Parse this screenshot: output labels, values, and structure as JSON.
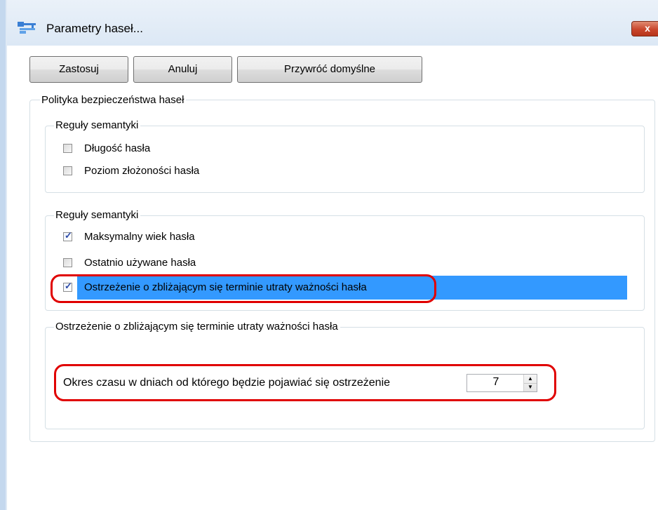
{
  "window": {
    "title": "Parametry haseł...",
    "close_glyph": "x",
    "icon": "app-key-icon"
  },
  "toolbar": {
    "apply_label": "Zastosuj",
    "cancel_label": "Anuluj",
    "restore_label": "Przywróć domyślne"
  },
  "policy": {
    "title": "Polityka bezpieczeństwa haseł",
    "semantics1": {
      "title": "Reguły semantyki",
      "items": [
        {
          "label": "Długość hasła",
          "checked": false
        },
        {
          "label": "Poziom złożoności hasła",
          "checked": false
        }
      ]
    },
    "semantics2": {
      "title": "Reguły semantyki",
      "items": [
        {
          "label": "Maksymalny wiek hasła",
          "checked": true
        },
        {
          "label": "Ostatnio używane hasła",
          "checked": false
        },
        {
          "label": "Ostrzeżenie o zbliżającym się terminie utraty ważności hasła",
          "checked": true,
          "selected": true
        }
      ]
    },
    "warning": {
      "title": "Ostrzeżenie o zbliżającym się terminie utraty ważności hasła",
      "period_label": "Okres czasu w dniach od którego będzie pojawiać się ostrzeżenie",
      "period_value": "7"
    }
  },
  "colors": {
    "selection": "#3399ff",
    "highlight_outline": "#e00000",
    "check_mark": "#2c4aa8"
  }
}
